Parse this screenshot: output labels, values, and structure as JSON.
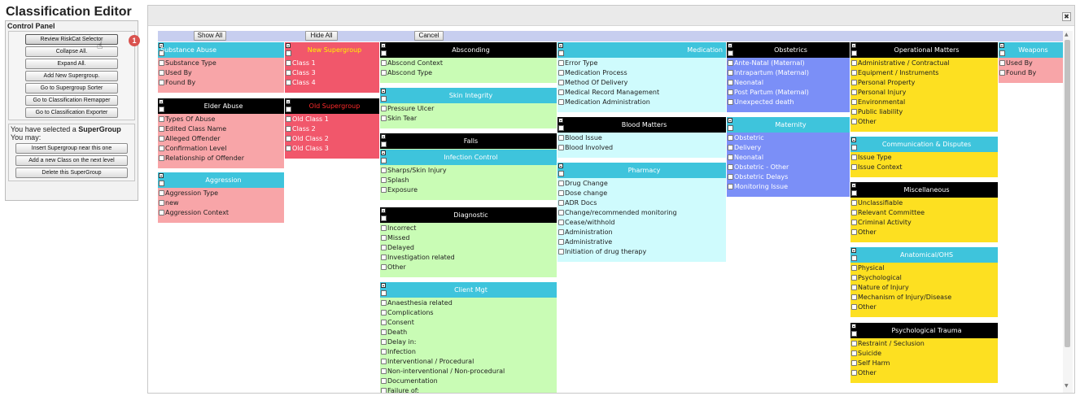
{
  "app": {
    "title": "Classification Editor"
  },
  "control_panel": {
    "title": "Control Panel",
    "buttons": [
      "Review RiskCat Selector",
      "Collapse All.",
      "Expand All.",
      "Add New Supergroup.",
      "Go to Supergroup Sorter",
      "Go to Classification Remapper",
      "Go to Classification Exporter"
    ],
    "badge": "1",
    "selection_text_prefix": "You have selected a",
    "selection_text_strong": "SuperGroup",
    "selection_text_may": "You may:",
    "selection_buttons": [
      "Insert Supergroup near this one",
      "Add a new Class on the next level",
      "Delete this SuperGroup"
    ]
  },
  "toolbar": {
    "show_all": "Show All",
    "hide_all": "Hide All",
    "cancel": "Cancel"
  },
  "close_label": "✖",
  "colors": {
    "pink": "#f8a5a8",
    "red": "#f1576b",
    "cyan": "#3ec4dc",
    "green": "#c9fcb5",
    "lightcyan": "#cffbfd",
    "blue": "#7b8ff7",
    "yellow": "#fde021",
    "black": "#000000"
  },
  "groups": [
    {
      "id": "substance-abuse",
      "title": "Substance Abuse",
      "header_color": "cyan",
      "title_color": "#ffffff",
      "body_color": "pink",
      "align": "left",
      "items": [
        "Substance Type",
        "Used By",
        "Found By"
      ]
    },
    {
      "id": "elder-abuse",
      "title": "Elder Abuse",
      "header_color": "black",
      "title_color": "#ffffff",
      "body_color": "pink",
      "align": "center",
      "items": [
        "Types Of Abuse",
        "Edited Class Name",
        "Alleged Offender",
        "Confirmation Level",
        "Relationship of Offender"
      ]
    },
    {
      "id": "aggression",
      "title": "Aggression",
      "header_color": "cyan",
      "title_color": "#ffffff",
      "body_color": "pink",
      "align": "center",
      "items": [
        "Aggression Type",
        "new",
        "Aggression Context"
      ]
    },
    {
      "id": "new-supergroup",
      "title": "New Supergroup",
      "header_color": "red",
      "title_color": "#fff200",
      "body_color": "red",
      "align": "center",
      "item_color": "#ffffff",
      "items": [
        "Class 1",
        "Class 3",
        "Class 4"
      ]
    },
    {
      "id": "old-supergroup",
      "title": "Old Supergroup",
      "header_color": "black",
      "title_color": "#ff2a2a",
      "body_color": "red",
      "align": "center",
      "item_color": "#ffffff",
      "items": [
        "Old Class 1",
        "Class 2",
        "Old Class 2",
        "Old Class 3"
      ]
    },
    {
      "id": "absconding",
      "title": "Absconding",
      "header_color": "black",
      "title_color": "#ffffff",
      "body_color": "green",
      "align": "center",
      "items": [
        "Abscond Context",
        "Abscond Type"
      ]
    },
    {
      "id": "skin-integrity",
      "title": "Skin Integrity",
      "header_color": "cyan",
      "title_color": "#ffffff",
      "body_color": "green",
      "align": "center",
      "items": [
        "Pressure Ulcer",
        "Skin Tear"
      ]
    },
    {
      "id": "falls",
      "title": "Falls",
      "header_color": "black",
      "title_color": "#ffffff",
      "body_color": "green",
      "align": "center",
      "expand": true,
      "items": []
    },
    {
      "id": "infection-control",
      "title": "Infection Control",
      "header_color": "cyan",
      "title_color": "#ffffff",
      "body_color": "green",
      "align": "center",
      "items": [
        "Sharps/Skin Injury",
        "Splash",
        "Exposure"
      ]
    },
    {
      "id": "diagnostic",
      "title": "Diagnostic",
      "header_color": "black",
      "title_color": "#ffffff",
      "body_color": "green",
      "align": "center",
      "items": [
        "Incorrect",
        "Missed",
        "Delayed",
        "Investigation related",
        "Other"
      ]
    },
    {
      "id": "client-mgt",
      "title": "Client Mgt",
      "header_color": "cyan",
      "title_color": "#ffffff",
      "body_color": "green",
      "align": "center",
      "items": [
        "Anaesthesia related",
        "Complications",
        "Consent",
        "Death",
        "Delay in:",
        "Infection",
        "Interventional / Procedural",
        "Non-interventional / Non-procedural",
        "Documentation",
        "Failure of:"
      ]
    },
    {
      "id": "medication",
      "title": "Medication",
      "header_color": "cyan",
      "title_color": "#ffffff",
      "body_color": "lightcyan",
      "align": "right",
      "items": [
        "Error Type",
        "Medication Process",
        "Method Of Delivery",
        "Medical Record Management",
        "Medication Administration"
      ]
    },
    {
      "id": "blood-matters",
      "title": "Blood Matters",
      "header_color": "black",
      "title_color": "#ffffff",
      "body_color": "lightcyan",
      "align": "center",
      "items": [
        "Blood Issue",
        "Blood Involved"
      ]
    },
    {
      "id": "pharmacy",
      "title": "Pharmacy",
      "header_color": "cyan",
      "title_color": "#ffffff",
      "body_color": "lightcyan",
      "align": "center",
      "items": [
        "Drug Change",
        "Dose change",
        "ADR Docs",
        "Change/recommended monitoring",
        "Cease/withhold",
        "Administration",
        "Administrative",
        "Initiation of drug therapy"
      ]
    },
    {
      "id": "obstetrics",
      "title": "Obstetrics",
      "header_color": "black",
      "title_color": "#ffffff",
      "body_color": "blue",
      "align": "center",
      "item_color": "#ffffff",
      "items": [
        "Ante-Natal (Maternal)",
        "Intrapartum (Maternal)",
        "Neonatal",
        "Post Partum (Maternal)",
        "Unexpected death"
      ]
    },
    {
      "id": "maternity",
      "title": "Maternity",
      "header_color": "cyan",
      "title_color": "#ffffff",
      "body_color": "blue",
      "align": "center",
      "item_color": "#ffffff",
      "items": [
        "Obstetric",
        "Delivery",
        "Neonatal",
        "Obstetric - Other",
        "Obstetric Delays",
        "Monitoring Issue"
      ]
    },
    {
      "id": "operational-matters",
      "title": "Operational Matters",
      "header_color": "black",
      "title_color": "#ffffff",
      "body_color": "yellow",
      "align": "center",
      "items": [
        "Administrative / Contractual",
        "Equipment / Instruments",
        "Personal Property",
        "Personal Injury",
        "Environmental",
        "Public liability",
        "Other"
      ]
    },
    {
      "id": "communication-disputes",
      "title": "Communication & Disputes",
      "header_color": "cyan",
      "title_color": "#ffffff",
      "body_color": "yellow",
      "align": "center",
      "items": [
        "Issue Type",
        "Issue Context"
      ]
    },
    {
      "id": "miscellaneous",
      "title": "Miscellaneous",
      "header_color": "black",
      "title_color": "#ffffff",
      "body_color": "yellow",
      "align": "center",
      "items": [
        "Unclassifiable",
        "Relevant Committee",
        "Criminal Activity",
        "Other"
      ]
    },
    {
      "id": "anatomical-ohs",
      "title": "Anatomical/OHS",
      "header_color": "cyan",
      "title_color": "#ffffff",
      "body_color": "yellow",
      "align": "center",
      "items": [
        "Physical",
        "Psychological",
        "Nature of Injury",
        "Mechanism of Injury/Disease",
        "Other"
      ]
    },
    {
      "id": "psychological-trauma",
      "title": "Psychological Trauma",
      "header_color": "black",
      "title_color": "#ffffff",
      "body_color": "yellow",
      "align": "center",
      "items": [
        "Restraint / Seclusion",
        "Suicide",
        "Self Harm",
        "Other"
      ]
    },
    {
      "id": "weapons",
      "title": "Weapons",
      "header_color": "cyan",
      "title_color": "#ffffff",
      "body_color": "pink",
      "align": "center",
      "items": [
        "Used By",
        "Found By"
      ]
    }
  ]
}
